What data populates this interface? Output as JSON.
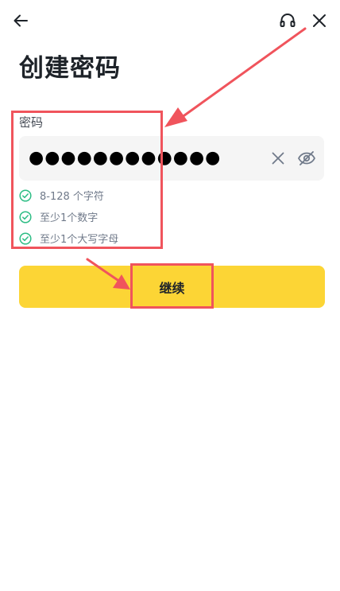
{
  "header": {
    "back_icon": "arrow-left-icon",
    "support_icon": "headset-icon",
    "close_icon": "close-icon"
  },
  "page": {
    "title": "创建密码"
  },
  "password_field": {
    "label": "密码",
    "value": "●●●●●●●●●●●●",
    "clear_icon": "clear-icon",
    "visibility_icon": "eye-off-icon"
  },
  "requirements": [
    {
      "text": "8-128 个字符",
      "met": true
    },
    {
      "text": "至少1个数字",
      "met": true
    },
    {
      "text": "至少1个大写字母",
      "met": true
    }
  ],
  "actions": {
    "continue_label": "继续"
  },
  "colors": {
    "accent": "#fcd535",
    "check": "#2ebd85",
    "annotation": "#f0545c",
    "input_bg": "#f5f5f5"
  }
}
